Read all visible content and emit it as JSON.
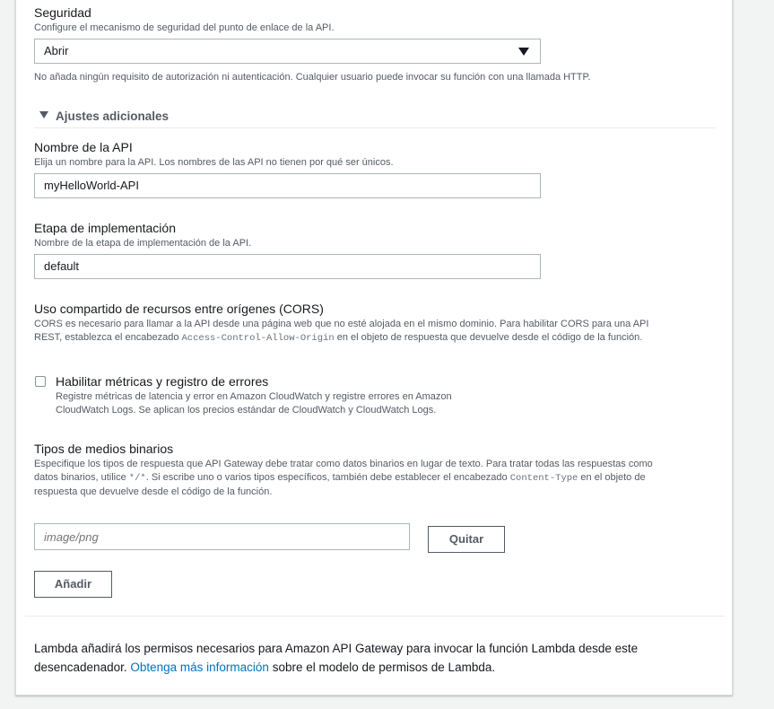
{
  "security": {
    "label": "Seguridad",
    "description": "Configure el mecanismo de seguridad del punto de enlace de la API.",
    "selected": "Abrir",
    "help": "No añada ningún requisito de autorización ni autenticación. Cualquier usuario puede invocar su función con una llamada HTTP."
  },
  "additional": {
    "toggle_label": "Ajustes adicionales"
  },
  "api_name": {
    "label": "Nombre de la API",
    "description": "Elija un nombre para la API. Los nombres de las API no tienen por qué ser únicos.",
    "value": "myHelloWorld-API"
  },
  "stage": {
    "label": "Etapa de implementación",
    "description": "Nombre de la etapa de implementación de la API.",
    "value": "default"
  },
  "cors": {
    "label": "Uso compartido de recursos entre orígenes (CORS)",
    "desc_line1": "CORS es necesario para llamar a la API desde una página web que no esté alojada en el mismo dominio. Para habilitar CORS para una API",
    "desc_line2_pre": "REST, establezca el encabezado",
    "header_code": "Access-Control-Allow-Origin",
    "desc_line2_post": "en el objeto de respuesta que devuelve desde el código de la función."
  },
  "metrics": {
    "label": "Habilitar métricas y registro de errores",
    "desc_line1": "Registre métricas de latencia y error en Amazon CloudWatch y registre errores en Amazon",
    "desc_line2": "CloudWatch Logs. Se aplican los precios estándar de CloudWatch y CloudWatch Logs.",
    "checked": false
  },
  "binary": {
    "label": "Tipos de medios binarios",
    "desc_line1": "Especifique los tipos de respuesta que API Gateway debe tratar como datos binarios en lugar de texto. Para tratar todas las respuestas como",
    "desc_line2_pre": "datos binarios, utilice",
    "wildcard_code": "*/*",
    "desc_line2_mid": ". Si escribe uno o varios tipos específicos, también debe establecer el encabezado",
    "content_type_code": "Content-Type",
    "desc_line2_post": "en el objeto de",
    "desc_line3": "respuesta que devuelve desde el código de la función.",
    "input_placeholder": "image/png",
    "remove_label": "Quitar",
    "add_label": "Añadir"
  },
  "footer": {
    "line1": "Lambda añadirá los permisos necesarios para Amazon API Gateway para invocar la función Lambda desde este",
    "line2_pre": "desencadenador.",
    "link": "Obtenga más información",
    "line2_post": "sobre el modelo de permisos de Lambda."
  },
  "colors": {
    "link": "#0073bb",
    "border": "#aab7b8",
    "text": "#16191f",
    "muted": "#545b64"
  }
}
